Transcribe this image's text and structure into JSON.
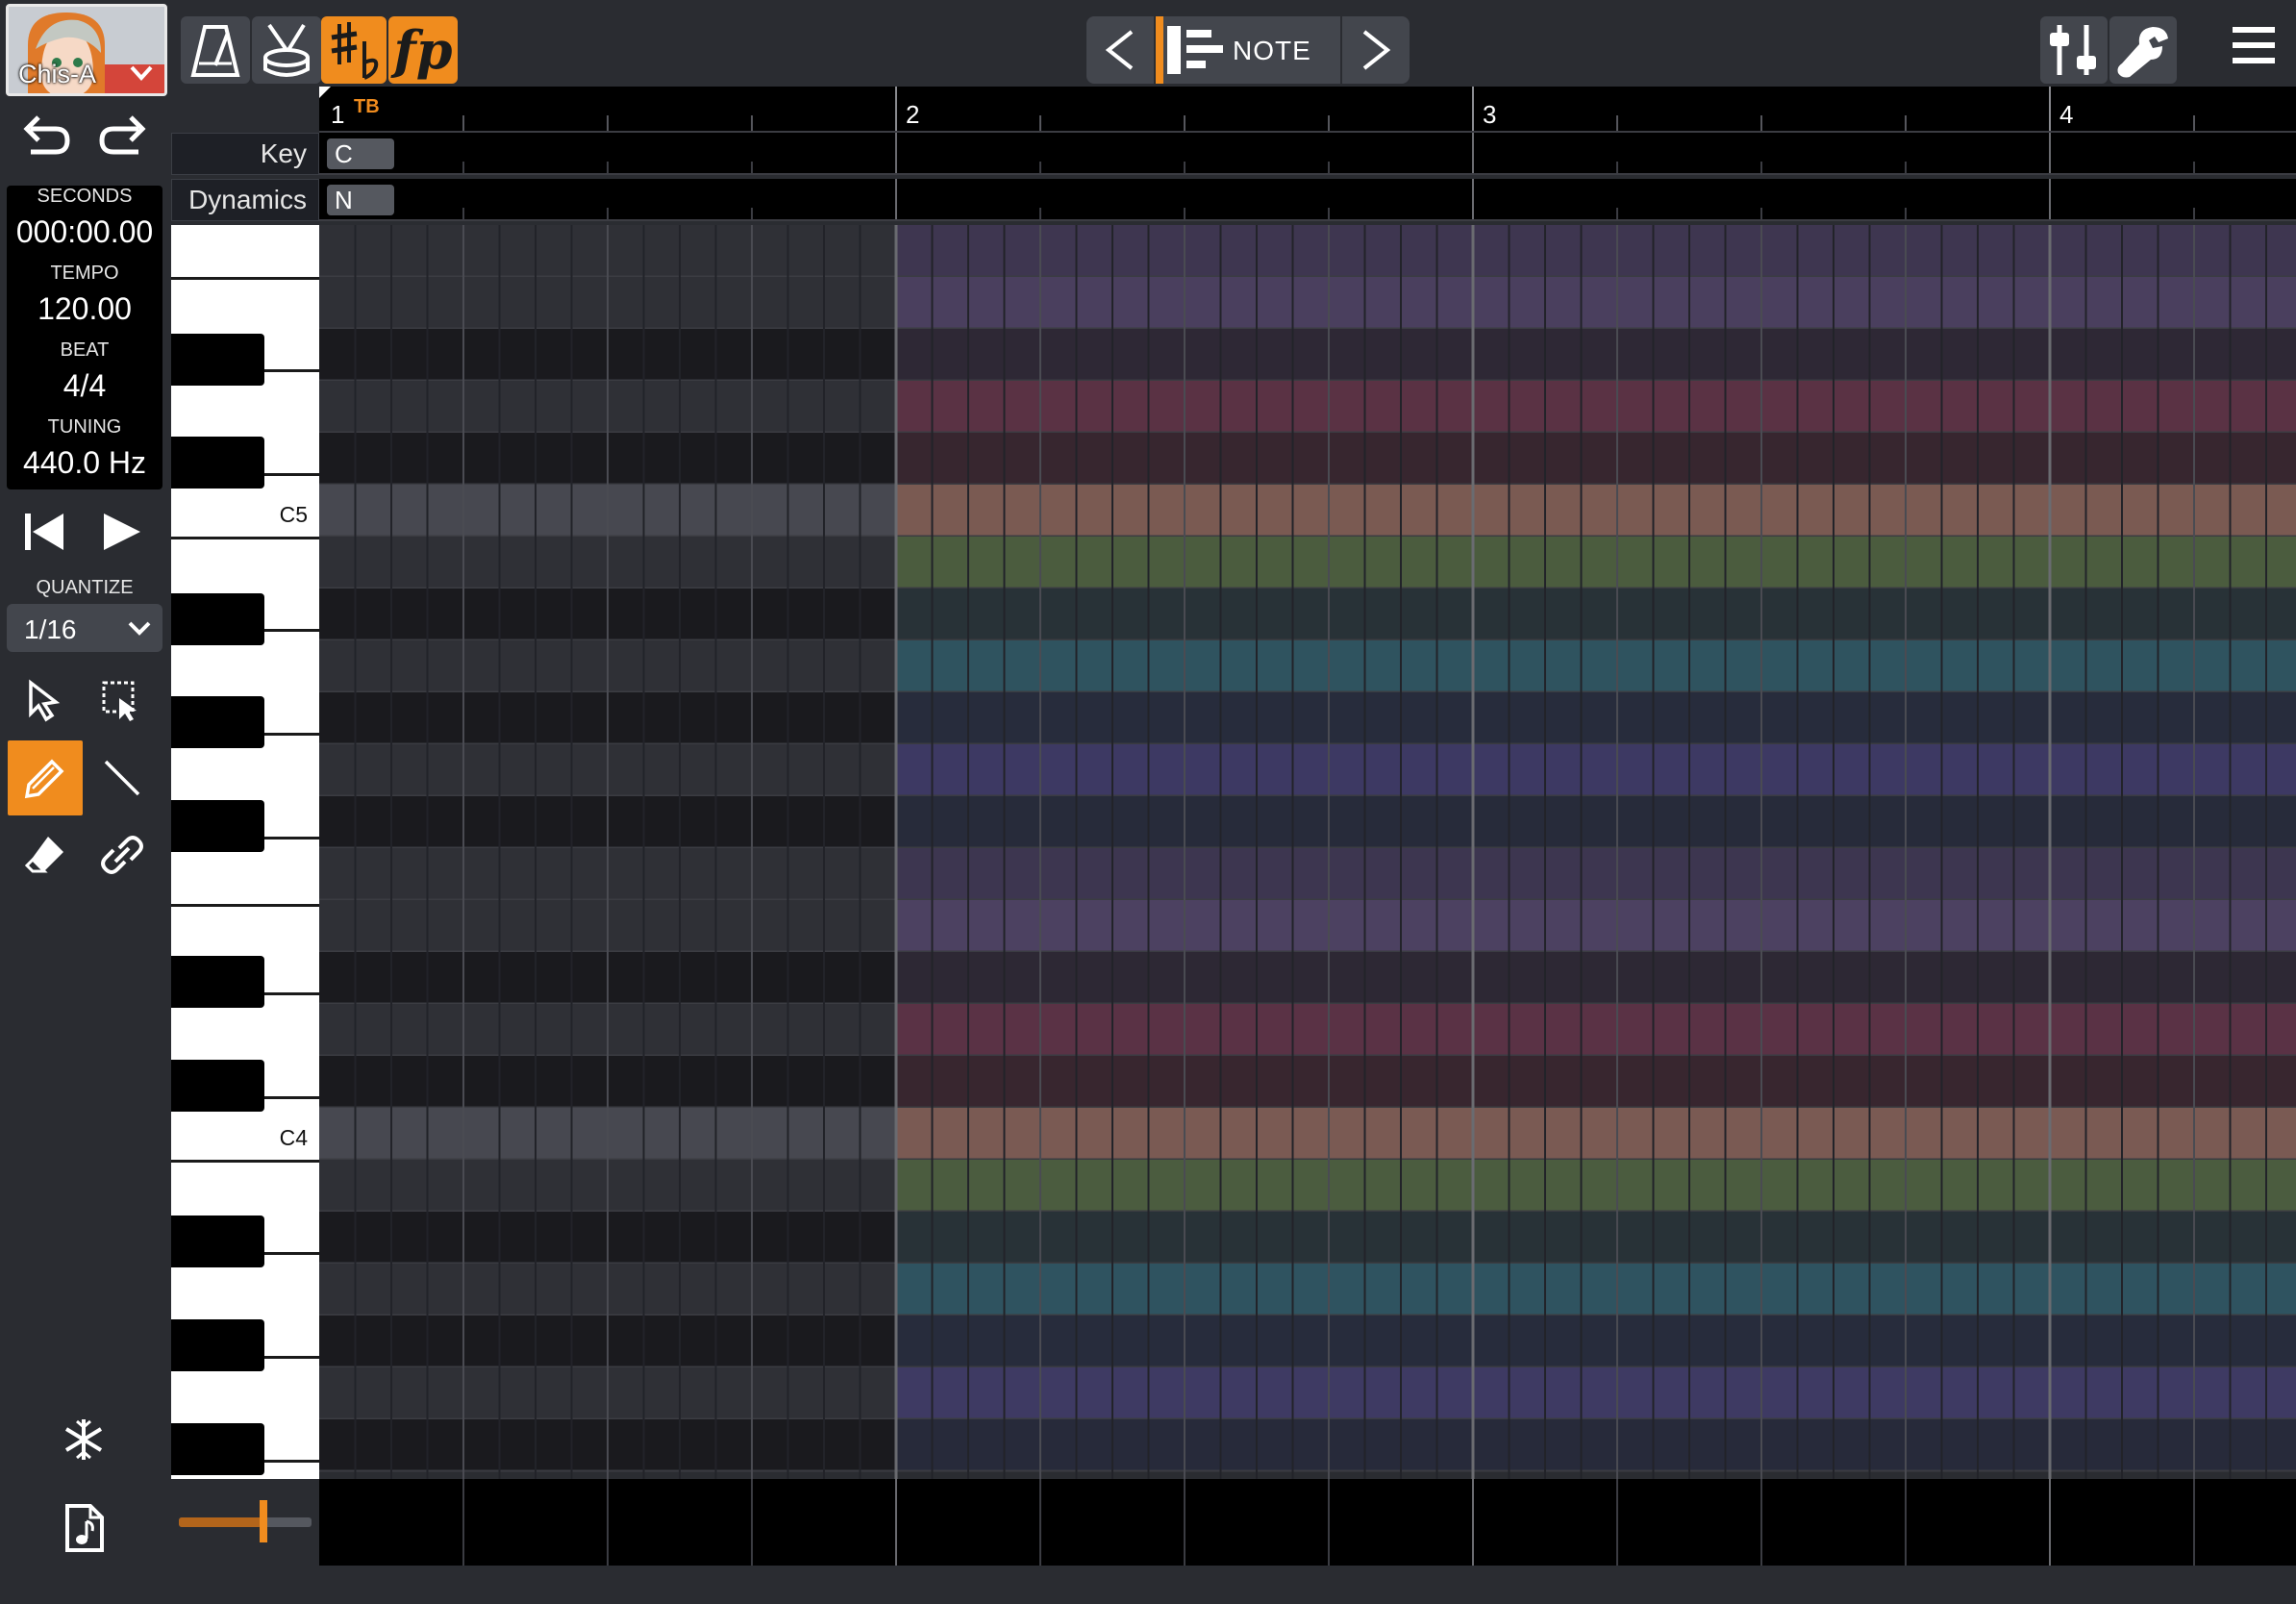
{
  "app": {
    "singer": {
      "name": "Chis-A"
    },
    "toolbar": {
      "metronome": "metronome-icon",
      "drum": "drum-icon",
      "accidentals": "sharp-flat-icon",
      "dynamics_glyph": "fp",
      "mode_label": "NOTE",
      "mixer": "mixer-icon",
      "settings": "wrench-icon",
      "menu": "hamburger-menu-icon"
    }
  },
  "transport": {
    "seconds_label": "SECONDS",
    "seconds_value": "000:00.00",
    "tempo_label": "TEMPO",
    "tempo_value": "120.00",
    "beat_label": "BEAT",
    "beat_value": "4/4",
    "tuning_label": "TUNING",
    "tuning_value": "440.0 Hz"
  },
  "quantize": {
    "label": "QUANTIZE",
    "value": "1/16"
  },
  "ruler": {
    "measures": [
      "1",
      "2",
      "3",
      "4"
    ],
    "tempo_beat_marker": "TB"
  },
  "rows": {
    "key": {
      "label": "Key",
      "value": "C"
    },
    "dynamics": {
      "label": "Dynamics",
      "value": "N"
    }
  },
  "keyboard": {
    "c5_label": "C5",
    "c4_label": "C4"
  },
  "colors": {
    "accent": "#f08c1e",
    "background": "#2a2c31",
    "grid_dark": "#1a1a1e",
    "grid_light": "#2f3036",
    "c_row": "#474850"
  },
  "scale_row_colors": [
    "#3e3650",
    "#4a3f5e",
    "#2e2835",
    "#5a3244",
    "#37262f",
    "#7a5a52",
    "#4b5c3e",
    "#283237",
    "#2f535f",
    "#272c3c",
    "#3d3963",
    "#272b3a",
    "#3d3650",
    "#4c4161",
    "#2d2834",
    "#5a3245",
    "#38262f",
    "#7a5a53",
    "#4b5c3f",
    "#283237",
    "#2f5360",
    "#272c3c",
    "#3e3a63",
    "#272a3a"
  ]
}
